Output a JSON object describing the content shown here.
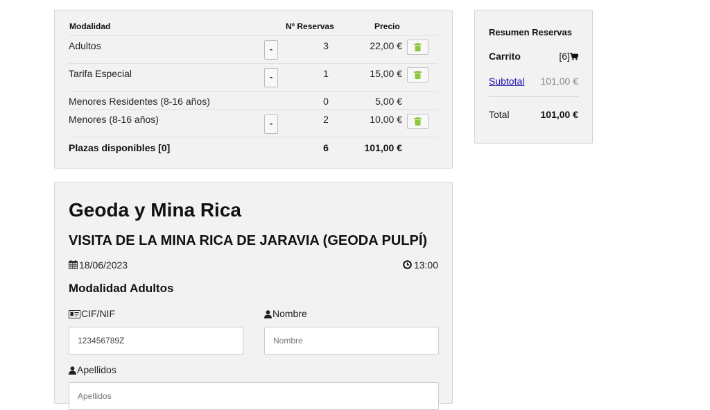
{
  "reservations": {
    "headers": {
      "modality": "Modalidad",
      "bookings": "Nº Reservas",
      "price": "Precio"
    },
    "rows": [
      {
        "name": "Adultos",
        "qty": "3",
        "price": "22,00 €",
        "has_controls": true
      },
      {
        "name": "Tarifa Especial",
        "qty": "1",
        "price": "15,00 €",
        "has_controls": true
      },
      {
        "name": "Menores Residentes (8-16 años)",
        "qty": "0",
        "price": "5,00 €",
        "has_controls": false
      },
      {
        "name": "Menores (8-16 años)",
        "qty": "2",
        "price": "10,00 €",
        "has_controls": true
      }
    ],
    "minus_label": "-",
    "footer": {
      "label": "Plazas disponibles [0]",
      "qty": "6",
      "total": "101,00 €"
    }
  },
  "summary": {
    "title": "Resumen Reservas",
    "cart_label": "Carrito",
    "cart_count": "[6]",
    "subtotal_label": "Subtotal",
    "subtotal_value": "101,00 €",
    "total_label": "Total",
    "total_value": "101,00 €"
  },
  "booking": {
    "title": "Geoda y Mina Rica",
    "subtitle": "VISITA DE LA MINA RICA DE JARAVIA (GEODA PULPÍ)",
    "date": "18/06/2023",
    "time": "13:00",
    "modality_heading": "Modalidad Adultos",
    "fields": {
      "id_label": "CIF/NIF",
      "id_value": "123456789Z",
      "name_label": "Nombre",
      "name_placeholder": "Nombre",
      "surname_label": "Apellidos",
      "surname_placeholder": "Apellidos"
    }
  },
  "colors": {
    "panel_bg": "#f2f2f2",
    "link": "#1a0dab",
    "trash_icon": "#8dc63f"
  },
  "icons": {
    "trash": "trash-icon",
    "cart": "shopping-cart-icon",
    "calendar": "calendar-icon",
    "clock": "clock-icon",
    "id_card": "id-card-icon",
    "user": "user-icon"
  }
}
